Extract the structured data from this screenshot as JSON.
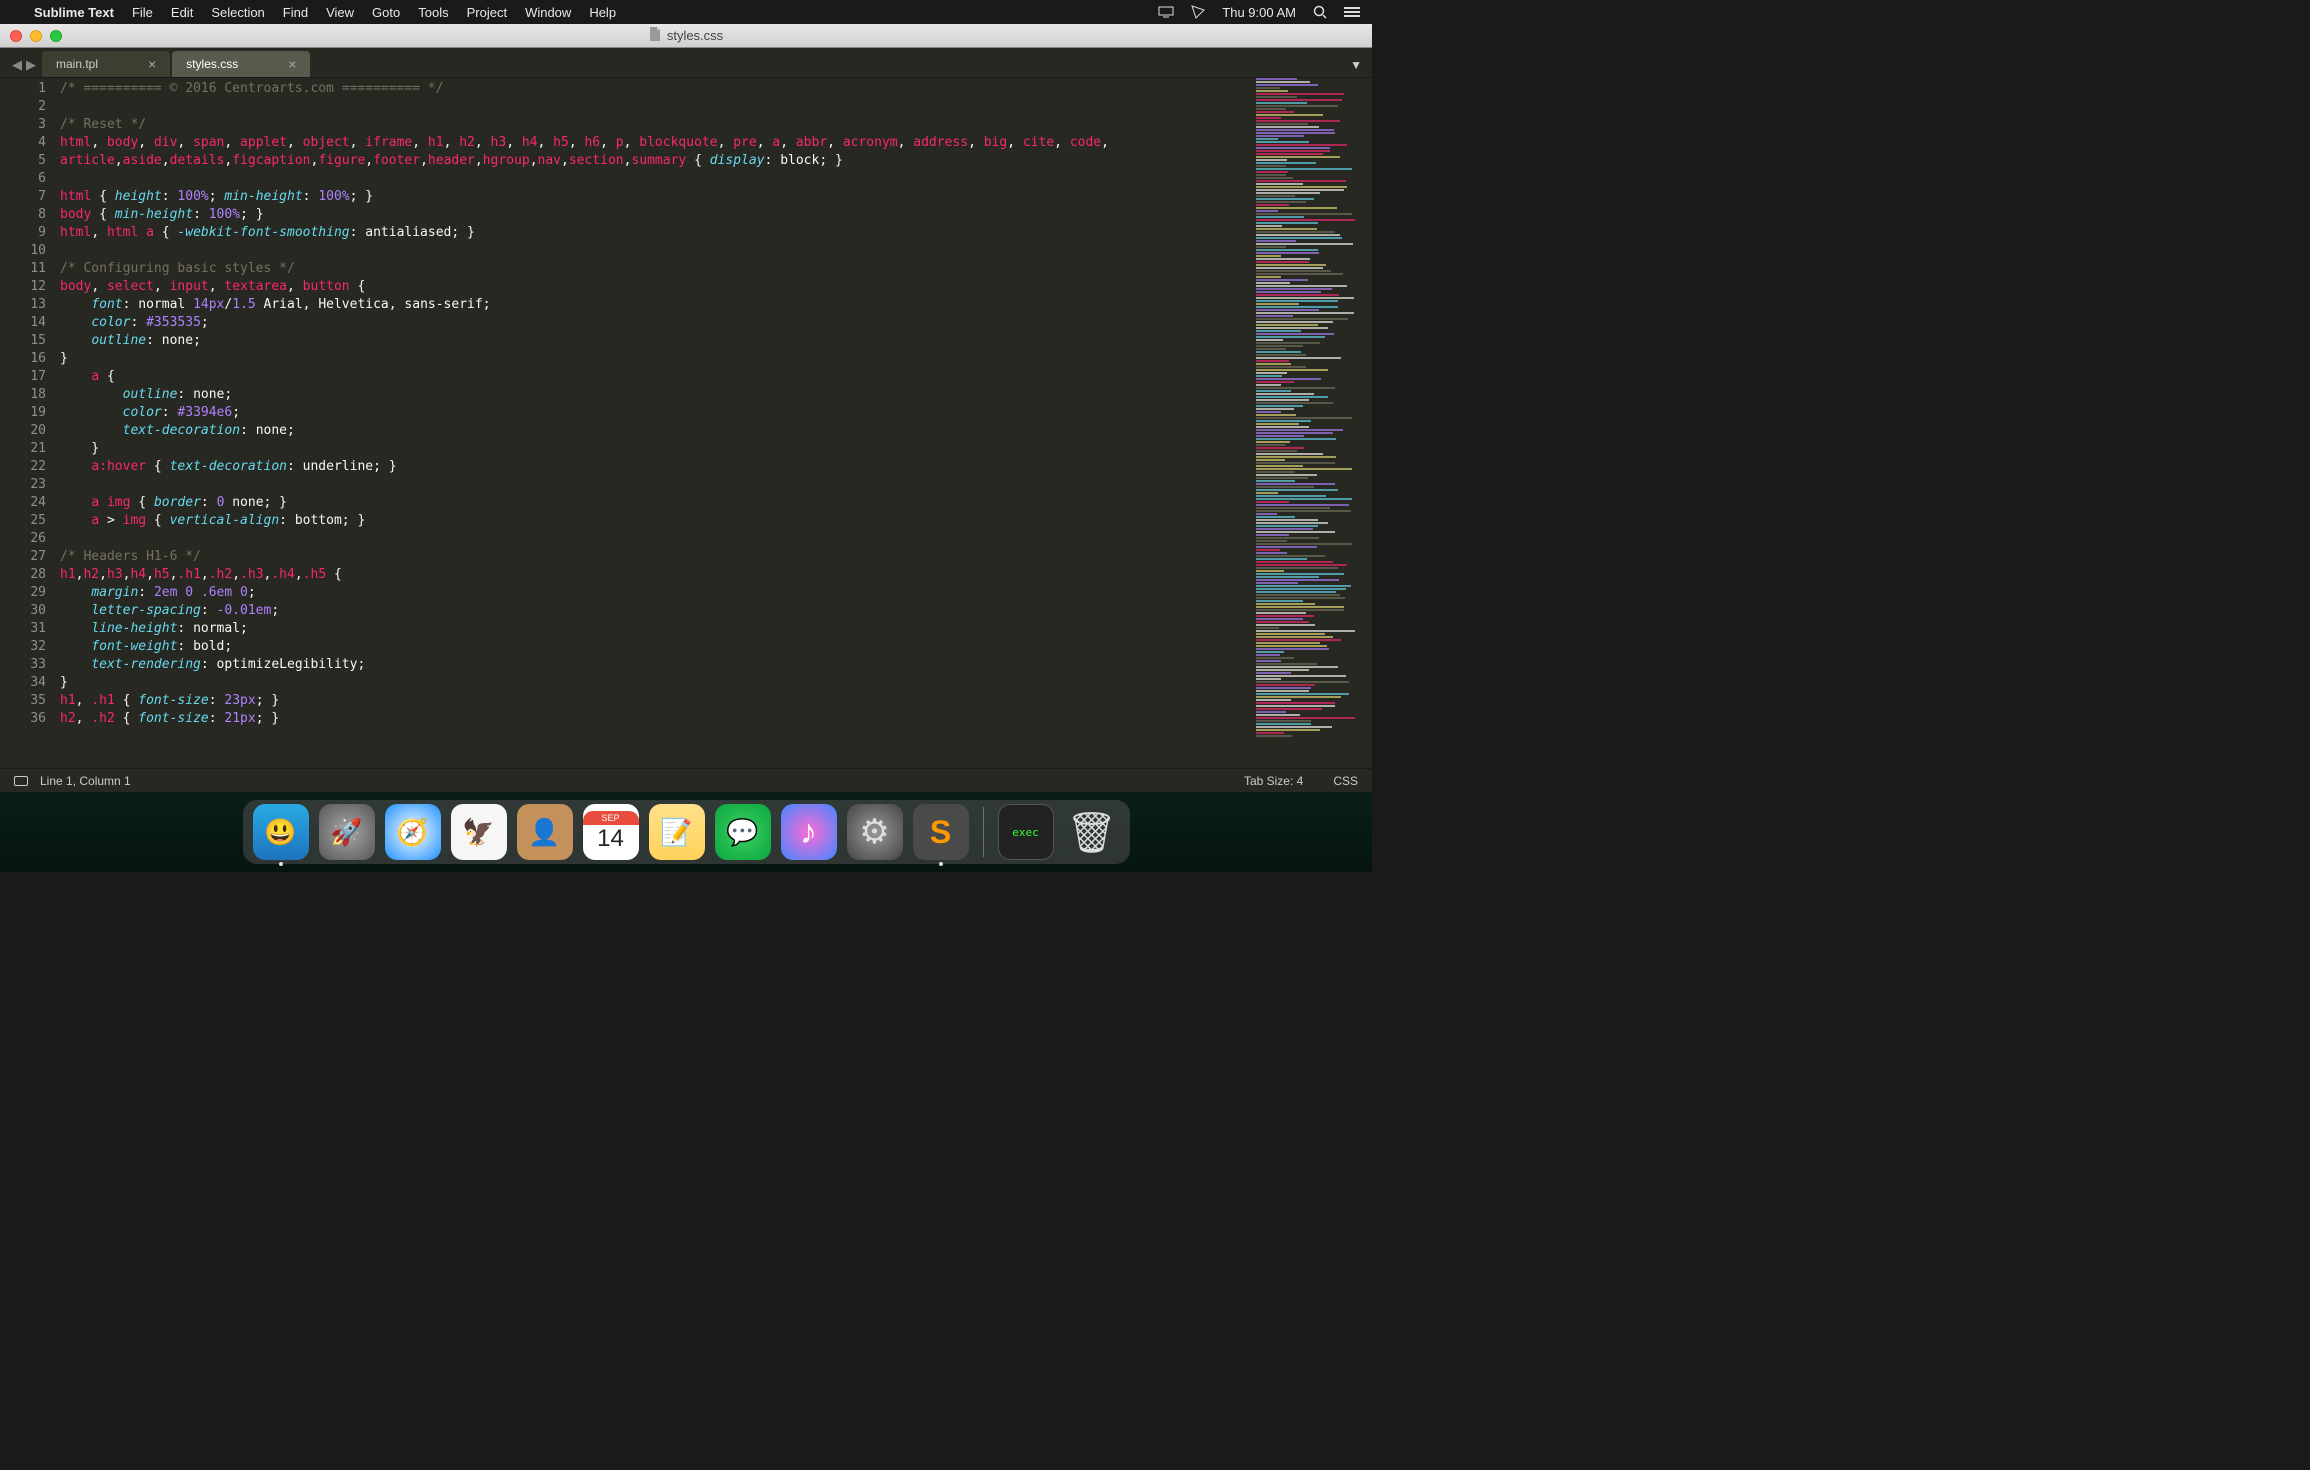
{
  "menubar": {
    "apple": "",
    "app": "Sublime Text",
    "items": [
      "File",
      "Edit",
      "Selection",
      "Find",
      "View",
      "Goto",
      "Tools",
      "Project",
      "Window",
      "Help"
    ],
    "clock": "Thu 9:00 AM"
  },
  "window": {
    "title": "styles.css"
  },
  "tabs": [
    {
      "label": "main.tpl",
      "active": false
    },
    {
      "label": "styles.css",
      "active": true
    }
  ],
  "code_lines": [
    [
      [
        "cmt",
        "/* ========== © 2016 Centroarts.com ========== */"
      ]
    ],
    [],
    [
      [
        "cmt",
        "/* Reset */"
      ]
    ],
    [
      [
        "sel",
        "html"
      ],
      [
        "punc",
        ", "
      ],
      [
        "sel",
        "body"
      ],
      [
        "punc",
        ", "
      ],
      [
        "sel",
        "div"
      ],
      [
        "punc",
        ", "
      ],
      [
        "sel",
        "span"
      ],
      [
        "punc",
        ", "
      ],
      [
        "sel",
        "applet"
      ],
      [
        "punc",
        ", "
      ],
      [
        "sel",
        "object"
      ],
      [
        "punc",
        ", "
      ],
      [
        "sel",
        "iframe"
      ],
      [
        "punc",
        ", "
      ],
      [
        "sel",
        "h1"
      ],
      [
        "punc",
        ", "
      ],
      [
        "sel",
        "h2"
      ],
      [
        "punc",
        ", "
      ],
      [
        "sel",
        "h3"
      ],
      [
        "punc",
        ", "
      ],
      [
        "sel",
        "h4"
      ],
      [
        "punc",
        ", "
      ],
      [
        "sel",
        "h5"
      ],
      [
        "punc",
        ", "
      ],
      [
        "sel",
        "h6"
      ],
      [
        "punc",
        ", "
      ],
      [
        "sel",
        "p"
      ],
      [
        "punc",
        ", "
      ],
      [
        "sel",
        "blockquote"
      ],
      [
        "punc",
        ", "
      ],
      [
        "sel",
        "pre"
      ],
      [
        "punc",
        ", "
      ],
      [
        "sel",
        "a"
      ],
      [
        "punc",
        ", "
      ],
      [
        "sel",
        "abbr"
      ],
      [
        "punc",
        ", "
      ],
      [
        "sel",
        "acronym"
      ],
      [
        "punc",
        ", "
      ],
      [
        "sel",
        "address"
      ],
      [
        "punc",
        ", "
      ],
      [
        "sel",
        "big"
      ],
      [
        "punc",
        ", "
      ],
      [
        "sel",
        "cite"
      ],
      [
        "punc",
        ", "
      ],
      [
        "sel",
        "code"
      ],
      [
        "punc",
        ", "
      ]
    ],
    [
      [
        "sel",
        "article"
      ],
      [
        "punc",
        ","
      ],
      [
        "sel",
        "aside"
      ],
      [
        "punc",
        ","
      ],
      [
        "sel",
        "details"
      ],
      [
        "punc",
        ","
      ],
      [
        "sel",
        "figcaption"
      ],
      [
        "punc",
        ","
      ],
      [
        "sel",
        "figure"
      ],
      [
        "punc",
        ","
      ],
      [
        "sel",
        "footer"
      ],
      [
        "punc",
        ","
      ],
      [
        "sel",
        "header"
      ],
      [
        "punc",
        ","
      ],
      [
        "sel",
        "hgroup"
      ],
      [
        "punc",
        ","
      ],
      [
        "sel",
        "nav"
      ],
      [
        "punc",
        ","
      ],
      [
        "sel",
        "section"
      ],
      [
        "punc",
        ","
      ],
      [
        "sel",
        "summary"
      ],
      [
        "punc",
        " { "
      ],
      [
        "prop",
        "display"
      ],
      [
        "punc",
        ": "
      ],
      [
        "val",
        "block"
      ],
      [
        "punc",
        "; }"
      ]
    ],
    [],
    [
      [
        "sel",
        "html"
      ],
      [
        "punc",
        " { "
      ],
      [
        "prop",
        "height"
      ],
      [
        "punc",
        ": "
      ],
      [
        "num",
        "100%"
      ],
      [
        "punc",
        "; "
      ],
      [
        "prop",
        "min-height"
      ],
      [
        "punc",
        ": "
      ],
      [
        "num",
        "100%"
      ],
      [
        "punc",
        "; }"
      ]
    ],
    [
      [
        "sel",
        "body"
      ],
      [
        "punc",
        " { "
      ],
      [
        "prop",
        "min-height"
      ],
      [
        "punc",
        ": "
      ],
      [
        "num",
        "100%"
      ],
      [
        "punc",
        "; }"
      ]
    ],
    [
      [
        "sel",
        "html"
      ],
      [
        "punc",
        ", "
      ],
      [
        "sel",
        "html a"
      ],
      [
        "punc",
        " { "
      ],
      [
        "prop",
        "-webkit-font-smoothing"
      ],
      [
        "punc",
        ": "
      ],
      [
        "val",
        "antialiased"
      ],
      [
        "punc",
        "; }"
      ]
    ],
    [],
    [
      [
        "cmt",
        "/* Configuring basic styles */"
      ]
    ],
    [
      [
        "sel",
        "body"
      ],
      [
        "punc",
        ", "
      ],
      [
        "sel",
        "select"
      ],
      [
        "punc",
        ", "
      ],
      [
        "sel",
        "input"
      ],
      [
        "punc",
        ", "
      ],
      [
        "sel",
        "textarea"
      ],
      [
        "punc",
        ", "
      ],
      [
        "sel",
        "button"
      ],
      [
        "punc",
        " {"
      ]
    ],
    [
      [
        "punc",
        "    "
      ],
      [
        "prop",
        "font"
      ],
      [
        "punc",
        ": "
      ],
      [
        "val",
        "normal "
      ],
      [
        "num",
        "14px"
      ],
      [
        "punc",
        "/"
      ],
      [
        "num",
        "1.5"
      ],
      [
        "val",
        " Arial, Helvetica, sans-serif"
      ],
      [
        "punc",
        ";"
      ]
    ],
    [
      [
        "punc",
        "    "
      ],
      [
        "prop",
        "color"
      ],
      [
        "punc",
        ": "
      ],
      [
        "num",
        "#353535"
      ],
      [
        "punc",
        ";"
      ]
    ],
    [
      [
        "punc",
        "    "
      ],
      [
        "prop",
        "outline"
      ],
      [
        "punc",
        ": "
      ],
      [
        "val",
        "none"
      ],
      [
        "punc",
        ";"
      ]
    ],
    [
      [
        "punc",
        "}"
      ]
    ],
    [
      [
        "punc",
        "    "
      ],
      [
        "sel",
        "a"
      ],
      [
        "punc",
        " {"
      ]
    ],
    [
      [
        "punc",
        "        "
      ],
      [
        "prop",
        "outline"
      ],
      [
        "punc",
        ": "
      ],
      [
        "val",
        "none"
      ],
      [
        "punc",
        ";"
      ]
    ],
    [
      [
        "punc",
        "        "
      ],
      [
        "prop",
        "color"
      ],
      [
        "punc",
        ": "
      ],
      [
        "num",
        "#3394e6"
      ],
      [
        "punc",
        ";"
      ]
    ],
    [
      [
        "punc",
        "        "
      ],
      [
        "prop",
        "text-decoration"
      ],
      [
        "punc",
        ": "
      ],
      [
        "val",
        "none"
      ],
      [
        "punc",
        ";"
      ]
    ],
    [
      [
        "punc",
        "    }"
      ]
    ],
    [
      [
        "punc",
        "    "
      ],
      [
        "sel",
        "a:hover"
      ],
      [
        "punc",
        " { "
      ],
      [
        "prop",
        "text-decoration"
      ],
      [
        "punc",
        ": "
      ],
      [
        "val",
        "underline"
      ],
      [
        "punc",
        "; }"
      ]
    ],
    [],
    [
      [
        "punc",
        "    "
      ],
      [
        "sel",
        "a img"
      ],
      [
        "punc",
        " { "
      ],
      [
        "prop",
        "border"
      ],
      [
        "punc",
        ": "
      ],
      [
        "num",
        "0"
      ],
      [
        "val",
        " none"
      ],
      [
        "punc",
        "; }"
      ]
    ],
    [
      [
        "punc",
        "    "
      ],
      [
        "sel",
        "a"
      ],
      [
        "punc",
        " > "
      ],
      [
        "sel",
        "img"
      ],
      [
        "punc",
        " { "
      ],
      [
        "prop",
        "vertical-align"
      ],
      [
        "punc",
        ": "
      ],
      [
        "val",
        "bottom"
      ],
      [
        "punc",
        "; }"
      ]
    ],
    [],
    [
      [
        "cmt",
        "/* Headers H1-6 */"
      ]
    ],
    [
      [
        "sel",
        "h1"
      ],
      [
        "punc",
        ","
      ],
      [
        "sel",
        "h2"
      ],
      [
        "punc",
        ","
      ],
      [
        "sel",
        "h3"
      ],
      [
        "punc",
        ","
      ],
      [
        "sel",
        "h4"
      ],
      [
        "punc",
        ","
      ],
      [
        "sel",
        "h5"
      ],
      [
        "punc",
        ","
      ],
      [
        "sel",
        ".h1"
      ],
      [
        "punc",
        ","
      ],
      [
        "sel",
        ".h2"
      ],
      [
        "punc",
        ","
      ],
      [
        "sel",
        ".h3"
      ],
      [
        "punc",
        ","
      ],
      [
        "sel",
        ".h4"
      ],
      [
        "punc",
        ","
      ],
      [
        "sel",
        ".h5"
      ],
      [
        "punc",
        " {"
      ]
    ],
    [
      [
        "punc",
        "    "
      ],
      [
        "prop",
        "margin"
      ],
      [
        "punc",
        ": "
      ],
      [
        "num",
        "2em 0 .6em 0"
      ],
      [
        "punc",
        ";"
      ]
    ],
    [
      [
        "punc",
        "    "
      ],
      [
        "prop",
        "letter-spacing"
      ],
      [
        "punc",
        ": "
      ],
      [
        "num",
        "-0.01em"
      ],
      [
        "punc",
        ";"
      ]
    ],
    [
      [
        "punc",
        "    "
      ],
      [
        "prop",
        "line-height"
      ],
      [
        "punc",
        ": "
      ],
      [
        "val",
        "normal"
      ],
      [
        "punc",
        ";"
      ]
    ],
    [
      [
        "punc",
        "    "
      ],
      [
        "prop",
        "font-weight"
      ],
      [
        "punc",
        ": "
      ],
      [
        "val",
        "bold"
      ],
      [
        "punc",
        ";"
      ]
    ],
    [
      [
        "punc",
        "    "
      ],
      [
        "prop",
        "text-rendering"
      ],
      [
        "punc",
        ": "
      ],
      [
        "val",
        "optimizeLegibility"
      ],
      [
        "punc",
        ";"
      ]
    ],
    [
      [
        "punc",
        "}"
      ]
    ],
    [
      [
        "sel",
        "h1"
      ],
      [
        "punc",
        ", "
      ],
      [
        "sel",
        ".h1"
      ],
      [
        "punc",
        " { "
      ],
      [
        "prop",
        "font-size"
      ],
      [
        "punc",
        ": "
      ],
      [
        "num",
        "23px"
      ],
      [
        "punc",
        "; }"
      ]
    ],
    [
      [
        "sel",
        "h2"
      ],
      [
        "punc",
        ", "
      ],
      [
        "sel",
        ".h2"
      ],
      [
        "punc",
        " { "
      ],
      [
        "prop",
        "font-size"
      ],
      [
        "punc",
        ": "
      ],
      [
        "num",
        "21px"
      ],
      [
        "punc",
        "; }"
      ]
    ]
  ],
  "status": {
    "cursor": "Line 1, Column 1",
    "tabsize": "Tab Size: 4",
    "language": "CSS"
  },
  "dock": {
    "apps": [
      {
        "name": "finder",
        "bg": "linear-gradient(#29abe2,#1e73be)",
        "glyph": "😃",
        "running": true
      },
      {
        "name": "launchpad",
        "bg": "radial-gradient(#aaa,#555)",
        "glyph": "🚀",
        "running": false
      },
      {
        "name": "safari",
        "bg": "radial-gradient(#fff,#1e90ff)",
        "glyph": "🧭",
        "running": false
      },
      {
        "name": "mail",
        "bg": "#f6f6f6",
        "glyph": "🦅",
        "running": false
      },
      {
        "name": "contacts",
        "bg": "#c5915a",
        "glyph": "👤",
        "running": false
      },
      {
        "name": "calendar",
        "bg": "#fff",
        "glyph": "",
        "running": false,
        "calendar": true
      },
      {
        "name": "notes",
        "bg": "linear-gradient(#ffe08a,#ffd35a)",
        "glyph": "📝",
        "running": false
      },
      {
        "name": "messages",
        "bg": "radial-gradient(#3dd264,#0aa53d)",
        "glyph": "💬",
        "running": false
      },
      {
        "name": "itunes",
        "bg": "radial-gradient(#ff6bd5,#3f87ff)",
        "glyph": "♪",
        "running": false
      },
      {
        "name": "system-preferences",
        "bg": "radial-gradient(#999,#444)",
        "glyph": "⚙︎",
        "running": false
      },
      {
        "name": "sublime-text",
        "bg": "#4a4a4a",
        "glyph": "S",
        "running": true
      }
    ],
    "right": [
      {
        "name": "terminal",
        "bg": "#222",
        "glyph": "exec"
      },
      {
        "name": "trash",
        "bg": "transparent",
        "glyph": "🗑"
      }
    ],
    "calendar": {
      "month": "SEP",
      "day": "14"
    }
  }
}
